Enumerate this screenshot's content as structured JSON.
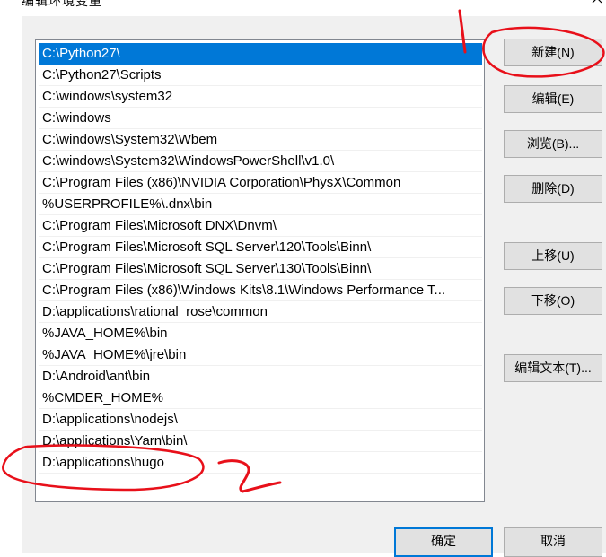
{
  "window": {
    "title": "编辑环境变量"
  },
  "path_list": {
    "items": [
      "C:\\Python27\\",
      "C:\\Python27\\Scripts",
      "C:\\windows\\system32",
      "C:\\windows",
      "C:\\windows\\System32\\Wbem",
      "C:\\windows\\System32\\WindowsPowerShell\\v1.0\\",
      "C:\\Program Files (x86)\\NVIDIA Corporation\\PhysX\\Common",
      "%USERPROFILE%\\.dnx\\bin",
      "C:\\Program Files\\Microsoft DNX\\Dnvm\\",
      "C:\\Program Files\\Microsoft SQL Server\\120\\Tools\\Binn\\",
      "C:\\Program Files\\Microsoft SQL Server\\130\\Tools\\Binn\\",
      "C:\\Program Files (x86)\\Windows Kits\\8.1\\Windows Performance T...",
      "D:\\applications\\rational_rose\\common",
      "%JAVA_HOME%\\bin",
      "%JAVA_HOME%\\jre\\bin",
      "D:\\Android\\ant\\bin",
      "%CMDER_HOME%",
      "D:\\applications\\nodejs\\",
      "D:\\applications\\Yarn\\bin\\",
      "D:\\applications\\hugo"
    ],
    "selected_index": 0
  },
  "buttons": {
    "new": "新建(N)",
    "edit": "编辑(E)",
    "browse": "浏览(B)...",
    "delete": "删除(D)",
    "move_up": "上移(U)",
    "move_down": "下移(O)",
    "edit_text": "编辑文本(T)...",
    "ok": "确定",
    "cancel": "取消"
  },
  "annotation_color": "#e8101a",
  "icons": {
    "close": "close-icon"
  }
}
